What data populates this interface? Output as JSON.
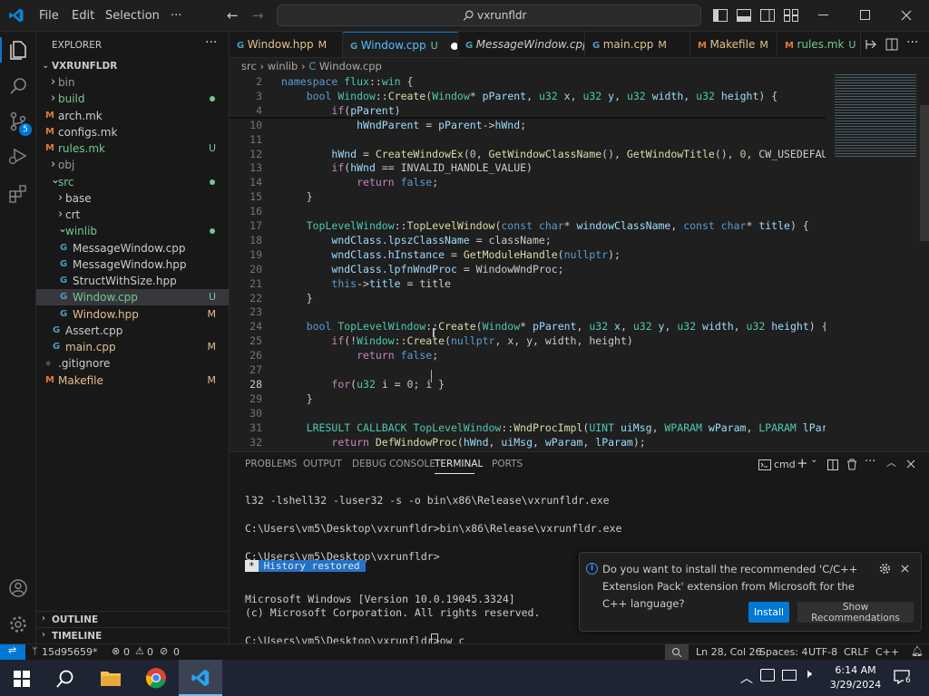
{
  "titlebar": {
    "menus": [
      "File",
      "Edit",
      "Selection",
      "···"
    ],
    "search_text": "vxrunfldr"
  },
  "activity_bar": {
    "items": [
      "explorer-icon",
      "search-icon",
      "source-control-icon",
      "run-debug-icon",
      "extensions-icon"
    ],
    "scm_badge": "5",
    "bottom": [
      "account-icon",
      "settings-icon"
    ]
  },
  "sidebar": {
    "title": "EXPLORER",
    "root": "VXRUNFLDR",
    "items": [
      {
        "label": "bin",
        "kind": "folder",
        "open": false,
        "depth": 1,
        "color": "#999999",
        "badge": ""
      },
      {
        "label": "build",
        "kind": "folder",
        "open": false,
        "depth": 1,
        "color": "#73c991",
        "badge": "dot"
      },
      {
        "label": "arch.mk",
        "kind": "mk",
        "depth": 1,
        "color": "#cccccc",
        "badge": ""
      },
      {
        "label": "configs.mk",
        "kind": "mk",
        "depth": 1,
        "color": "#cccccc",
        "badge": ""
      },
      {
        "label": "rules.mk",
        "kind": "mk",
        "depth": 1,
        "color": "#73c991",
        "badge": "U"
      },
      {
        "label": "obj",
        "kind": "folder",
        "open": false,
        "depth": 1,
        "color": "#999999",
        "badge": ""
      },
      {
        "label": "src",
        "kind": "folder",
        "open": true,
        "depth": 1,
        "color": "#73c991",
        "badge": "dot"
      },
      {
        "label": "base",
        "kind": "folder",
        "open": false,
        "depth": 2,
        "color": "#cccccc",
        "badge": ""
      },
      {
        "label": "crt",
        "kind": "folder",
        "open": false,
        "depth": 2,
        "color": "#cccccc",
        "badge": ""
      },
      {
        "label": "winlib",
        "kind": "folder",
        "open": true,
        "depth": 2,
        "color": "#73c991",
        "badge": "dot"
      },
      {
        "label": "MessageWindow.cpp",
        "kind": "cpp",
        "depth": 3,
        "color": "#cccccc",
        "badge": ""
      },
      {
        "label": "MessageWindow.hpp",
        "kind": "cpp",
        "depth": 3,
        "color": "#cccccc",
        "badge": ""
      },
      {
        "label": "StructWithSize.hpp",
        "kind": "cpp",
        "depth": 3,
        "color": "#cccccc",
        "badge": ""
      },
      {
        "label": "Window.cpp",
        "kind": "cpp",
        "depth": 3,
        "color": "#73c991",
        "badge": "U",
        "selected": true
      },
      {
        "label": "Window.hpp",
        "kind": "cpp",
        "depth": 3,
        "color": "#e2c08d",
        "badge": "M"
      },
      {
        "label": "Assert.cpp",
        "kind": "cpp",
        "depth": 2,
        "color": "#cccccc",
        "badge": ""
      },
      {
        "label": "main.cpp",
        "kind": "cpp",
        "depth": 2,
        "color": "#e2c08d",
        "badge": "M"
      },
      {
        "label": ".gitignore",
        "kind": "git",
        "depth": 1,
        "color": "#cccccc",
        "badge": ""
      },
      {
        "label": "Makefile",
        "kind": "mk",
        "depth": 1,
        "color": "#e2c08d",
        "badge": "M"
      }
    ],
    "outline": "OUTLINE",
    "timeline": "TIMELINE"
  },
  "tabs": [
    {
      "label": "Window.hpp",
      "status": "M",
      "active": false,
      "italic": false,
      "icon": "cpp"
    },
    {
      "label": "Window.cpp",
      "status": "U",
      "active": true,
      "italic": false,
      "icon": "cpp",
      "dirty": true
    },
    {
      "label": "MessageWindow.cpp",
      "status": "",
      "active": false,
      "italic": true,
      "icon": "cpp"
    },
    {
      "label": "main.cpp",
      "status": "M",
      "active": false,
      "italic": false,
      "icon": "cpp"
    },
    {
      "label": "Makefile",
      "status": "M",
      "active": false,
      "italic": false,
      "icon": "mk"
    },
    {
      "label": "rules.mk",
      "status": "U",
      "active": false,
      "italic": false,
      "icon": "mk"
    }
  ],
  "breadcrumb": [
    "src",
    "winlib",
    "Window.cpp"
  ],
  "code": [
    {
      "n": "2",
      "t": [
        [
          "kw",
          "namespace "
        ],
        [
          "ty",
          "flux"
        ],
        [
          "",
          "::"
        ],
        [
          "ty",
          "win"
        ],
        [
          "",
          " {"
        ]
      ]
    },
    {
      "n": "3",
      "t": [
        [
          "",
          "    "
        ],
        [
          "kw",
          "bool "
        ],
        [
          "ty",
          "Window"
        ],
        [
          "",
          "::"
        ],
        [
          "fn",
          "Create"
        ],
        [
          "",
          "("
        ],
        [
          "ty",
          "Window"
        ],
        [
          "",
          "* "
        ],
        [
          "var",
          "pParent"
        ],
        [
          "",
          ", "
        ],
        [
          "ty",
          "u32 "
        ],
        [
          "var",
          "x"
        ],
        [
          "",
          ", "
        ],
        [
          "ty",
          "u32 "
        ],
        [
          "var",
          "y"
        ],
        [
          "",
          ", "
        ],
        [
          "ty",
          "u32 "
        ],
        [
          "var",
          "width"
        ],
        [
          "",
          ", "
        ],
        [
          "ty",
          "u32 "
        ],
        [
          "var",
          "height"
        ],
        [
          "",
          ") {"
        ]
      ]
    },
    {
      "n": "4",
      "t": [
        [
          "",
          "        "
        ],
        [
          "ctl",
          "if"
        ],
        [
          "",
          "("
        ],
        [
          "var",
          "pParent"
        ],
        [
          "",
          ")"
        ]
      ]
    },
    {
      "n": "10",
      "t": [
        [
          "",
          "            "
        ],
        [
          "var",
          "hWndParent"
        ],
        [
          "",
          " = "
        ],
        [
          "var",
          "pParent"
        ],
        [
          "",
          "->"
        ],
        [
          "var",
          "hWnd"
        ],
        [
          "",
          ";"
        ]
      ]
    },
    {
      "n": "11",
      "t": [
        [
          "",
          ""
        ]
      ]
    },
    {
      "n": "12",
      "t": [
        [
          "",
          "        "
        ],
        [
          "var",
          "hWnd"
        ],
        [
          "",
          " = "
        ],
        [
          "fn",
          "CreateWindowEx"
        ],
        [
          "",
          "("
        ],
        [
          "num",
          "0"
        ],
        [
          "",
          ", "
        ],
        [
          "fn",
          "GetWindowClassName"
        ],
        [
          "",
          "(), "
        ],
        [
          "fn",
          "GetWindowTitle"
        ],
        [
          "",
          "(), "
        ],
        [
          "num",
          "0"
        ],
        [
          "",
          ", CW_USEDEFAULT, CW_"
        ]
      ]
    },
    {
      "n": "13",
      "t": [
        [
          "",
          "        "
        ],
        [
          "ctl",
          "if"
        ],
        [
          "",
          "("
        ],
        [
          "var",
          "hWnd"
        ],
        [
          "",
          " == INVALID_HANDLE_VALUE)"
        ]
      ]
    },
    {
      "n": "14",
      "t": [
        [
          "",
          "            "
        ],
        [
          "ctl",
          "return "
        ],
        [
          "kw",
          "false"
        ],
        [
          "",
          ";"
        ]
      ]
    },
    {
      "n": "15",
      "t": [
        [
          "",
          "    }"
        ]
      ]
    },
    {
      "n": "16",
      "t": [
        [
          "",
          ""
        ]
      ]
    },
    {
      "n": "17",
      "t": [
        [
          "",
          "    "
        ],
        [
          "ty",
          "TopLevelWindow"
        ],
        [
          "",
          "::"
        ],
        [
          "fn",
          "TopLevelWindow"
        ],
        [
          "",
          "("
        ],
        [
          "kw",
          "const "
        ],
        [
          "kw",
          "char"
        ],
        [
          "",
          "* "
        ],
        [
          "var",
          "windowClassName"
        ],
        [
          "",
          ", "
        ],
        [
          "kw",
          "const "
        ],
        [
          "kw",
          "char"
        ],
        [
          "",
          "* "
        ],
        [
          "var",
          "title"
        ],
        [
          "",
          ") {"
        ]
      ]
    },
    {
      "n": "18",
      "t": [
        [
          "",
          "        "
        ],
        [
          "var",
          "wndClass"
        ],
        [
          "",
          "."
        ],
        [
          "var",
          "lpszClassName"
        ],
        [
          "",
          " = className;"
        ]
      ]
    },
    {
      "n": "19",
      "t": [
        [
          "",
          "        "
        ],
        [
          "var",
          "wndClass"
        ],
        [
          "",
          "."
        ],
        [
          "var",
          "hInstance"
        ],
        [
          "",
          " = "
        ],
        [
          "fn",
          "GetModuleHandle"
        ],
        [
          "",
          "("
        ],
        [
          "kw",
          "nullptr"
        ],
        [
          "",
          ");"
        ]
      ]
    },
    {
      "n": "20",
      "t": [
        [
          "",
          "        "
        ],
        [
          "var",
          "wndClass"
        ],
        [
          "",
          "."
        ],
        [
          "var",
          "lpfnWndProc"
        ],
        [
          "",
          " = WindowWndProc;"
        ]
      ]
    },
    {
      "n": "21",
      "t": [
        [
          "",
          "        "
        ],
        [
          "kw",
          "this"
        ],
        [
          "",
          "->"
        ],
        [
          "var",
          "title"
        ],
        [
          "",
          " = title"
        ]
      ]
    },
    {
      "n": "22",
      "t": [
        [
          "",
          "    }"
        ]
      ]
    },
    {
      "n": "23",
      "t": [
        [
          "",
          ""
        ]
      ]
    },
    {
      "n": "24",
      "t": [
        [
          "",
          "    "
        ],
        [
          "kw",
          "bool "
        ],
        [
          "ty",
          "TopLevelWindow"
        ],
        [
          "",
          "::"
        ],
        [
          "fn",
          "Create"
        ],
        [
          "",
          "("
        ],
        [
          "ty",
          "Window"
        ],
        [
          "",
          "* "
        ],
        [
          "var",
          "pParent"
        ],
        [
          "",
          ", "
        ],
        [
          "ty",
          "u32 "
        ],
        [
          "var",
          "x"
        ],
        [
          "",
          ", "
        ],
        [
          "ty",
          "u32 "
        ],
        [
          "var",
          "y"
        ],
        [
          "",
          ", "
        ],
        [
          "ty",
          "u32 "
        ],
        [
          "var",
          "width"
        ],
        [
          "",
          ", "
        ],
        [
          "ty",
          "u32 "
        ],
        [
          "var",
          "height"
        ],
        [
          "",
          ") {"
        ]
      ]
    },
    {
      "n": "25",
      "t": [
        [
          "",
          "        "
        ],
        [
          "ctl",
          "if"
        ],
        [
          "",
          "(!"
        ],
        [
          "ty",
          "Window"
        ],
        [
          "",
          "::"
        ],
        [
          "fn",
          "Create"
        ],
        [
          "",
          "("
        ],
        [
          "kw",
          "nullptr"
        ],
        [
          "",
          ", x, y, width, height)"
        ]
      ]
    },
    {
      "n": "26",
      "t": [
        [
          "",
          "            "
        ],
        [
          "ctl",
          "return "
        ],
        [
          "kw",
          "false"
        ],
        [
          "",
          ";"
        ]
      ]
    },
    {
      "n": "27",
      "t": [
        [
          "",
          ""
        ]
      ]
    },
    {
      "n": "28",
      "t": [
        [
          "",
          "        "
        ],
        [
          "ctl",
          "for"
        ],
        [
          "",
          "("
        ],
        [
          "ty",
          "u32 "
        ],
        [
          "var",
          "i"
        ],
        [
          "",
          " = "
        ],
        [
          "num",
          "0"
        ],
        [
          "",
          "; i "
        ],
        [
          "",
          "}"
        ]
      ]
    },
    {
      "n": "29",
      "t": [
        [
          "",
          "    }"
        ]
      ]
    },
    {
      "n": "30",
      "t": [
        [
          "",
          ""
        ]
      ]
    },
    {
      "n": "31",
      "t": [
        [
          "",
          "    "
        ],
        [
          "ty",
          "LRESULT CALLBACK "
        ],
        [
          "ty",
          "TopLevelWindow"
        ],
        [
          "",
          "::"
        ],
        [
          "fn",
          "WndProcImpl"
        ],
        [
          "",
          "("
        ],
        [
          "ty",
          "UINT "
        ],
        [
          "var",
          "uiMsg"
        ],
        [
          "",
          ", "
        ],
        [
          "ty",
          "WPARAM "
        ],
        [
          "var",
          "wParam"
        ],
        [
          "",
          ", "
        ],
        [
          "ty",
          "LPARAM "
        ],
        [
          "var",
          "lParam"
        ],
        [
          "",
          ") {"
        ]
      ]
    },
    {
      "n": "32",
      "t": [
        [
          "",
          "        "
        ],
        [
          "ctl",
          "return "
        ],
        [
          "fn",
          "DefWindowProc"
        ],
        [
          "",
          "("
        ],
        [
          "var",
          "hWnd"
        ],
        [
          "",
          ", "
        ],
        [
          "var",
          "uiMsg"
        ],
        [
          "",
          ", "
        ],
        [
          "var",
          "wParam"
        ],
        [
          "",
          ", "
        ],
        [
          "var",
          "lParam"
        ],
        [
          "",
          ");"
        ]
      ]
    },
    {
      "n": "33",
      "t": [
        [
          "",
          "    }"
        ]
      ]
    }
  ],
  "panel": {
    "tabs": [
      "PROBLEMS",
      "OUTPUT",
      "DEBUG CONSOLE",
      "TERMINAL",
      "PORTS"
    ],
    "active_tab": "TERMINAL",
    "shell": "cmd",
    "terminal_lines": [
      "l32 -lshell32 -luser32 -s -o bin\\x86\\Release\\vxrunfldr.exe",
      "",
      "C:\\Users\\vm5\\Desktop\\vxrunfldr>bin\\x86\\Release\\vxrunfldr.exe",
      "",
      "C:\\Users\\vm5\\Desktop\\vxrunfldr>",
      "",
      "",
      "Microsoft Windows [Version 10.0.19045.3324]",
      "(c) Microsoft Corporation. All rights reserved.",
      "",
      "C:\\Users\\vm5\\Desktop\\vxrunfldr>ow c"
    ],
    "history_restored": "History restored",
    "history_marker": "*"
  },
  "notification": {
    "message": "Do you want to install the recommended 'C/C++ Extension Pack' extension from Microsoft for the C++ language?",
    "install": "Install",
    "show_recommendations": "Show Recommendations"
  },
  "statusbar": {
    "branch": "15d95659*",
    "errors": "0",
    "warnings": "0",
    "ports": "0",
    "position": "Ln 28, Col 26",
    "spaces": "Spaces: 4",
    "encoding": "UTF-8",
    "eol": "CRLF",
    "language": "C++"
  },
  "taskbar": {
    "time": "6:14 AM",
    "date": "3/29/2024",
    "notification_count": "6"
  },
  "colors": {
    "accent": "#0078d4",
    "modified": "#e2c08d",
    "untracked": "#73c991",
    "bg": "#1f1f1f"
  }
}
